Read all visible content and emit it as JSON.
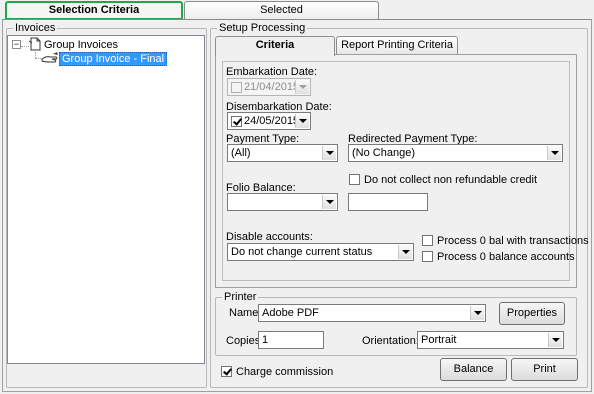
{
  "tabs": [
    {
      "label": "Selection Criteria",
      "active": true
    },
    {
      "label": "Selected",
      "active": false
    }
  ],
  "invoices": {
    "title": "Invoices",
    "tree": {
      "root_label": "Group Invoices",
      "child_label": "Group Invoice - Final",
      "expander": "⊟"
    }
  },
  "setup": {
    "title": "Setup Processing",
    "tabs": [
      {
        "label": "Criteria",
        "active": true
      },
      {
        "label": "Report Printing Criteria",
        "active": false
      }
    ],
    "embarkation": {
      "label": "Embarkation Date:",
      "value": "21/04/2015",
      "checked": false
    },
    "disembarkation": {
      "label": "Disembarkation Date:",
      "value": "24/05/2015",
      "checked": true
    },
    "payment_type": {
      "label": "Payment Type:",
      "value": "(All)"
    },
    "redirected_payment_type": {
      "label": "Redirected Payment Type:",
      "value": "(No Change)"
    },
    "non_refundable": {
      "label": "Do not collect non refundable credit",
      "checked": false
    },
    "folio_balance": {
      "label": "Folio Balance:",
      "value": "",
      "amount": ""
    },
    "disable_accounts": {
      "label": "Disable accounts:",
      "value": "Do not change current status"
    },
    "process_zero_bal_tx": {
      "label": "Process 0 bal with transactions",
      "checked": false
    },
    "process_zero_bal_accounts": {
      "label": "Process 0 balance accounts",
      "checked": false
    }
  },
  "printer": {
    "title": "Printer",
    "name_label": "Name:",
    "name_value": "Adobe PDF",
    "properties_label": "Properties",
    "copies_label": "Copies:",
    "copies_value": "1",
    "orientation_label": "Orientation:",
    "orientation_value": "Portrait"
  },
  "footer": {
    "charge_commission": {
      "label": "Charge commission",
      "checked": true
    },
    "balance_label": "Balance",
    "print_label": "Print"
  },
  "colors": {
    "active_tab_border": "#22a548",
    "selection": "#3399ff"
  }
}
